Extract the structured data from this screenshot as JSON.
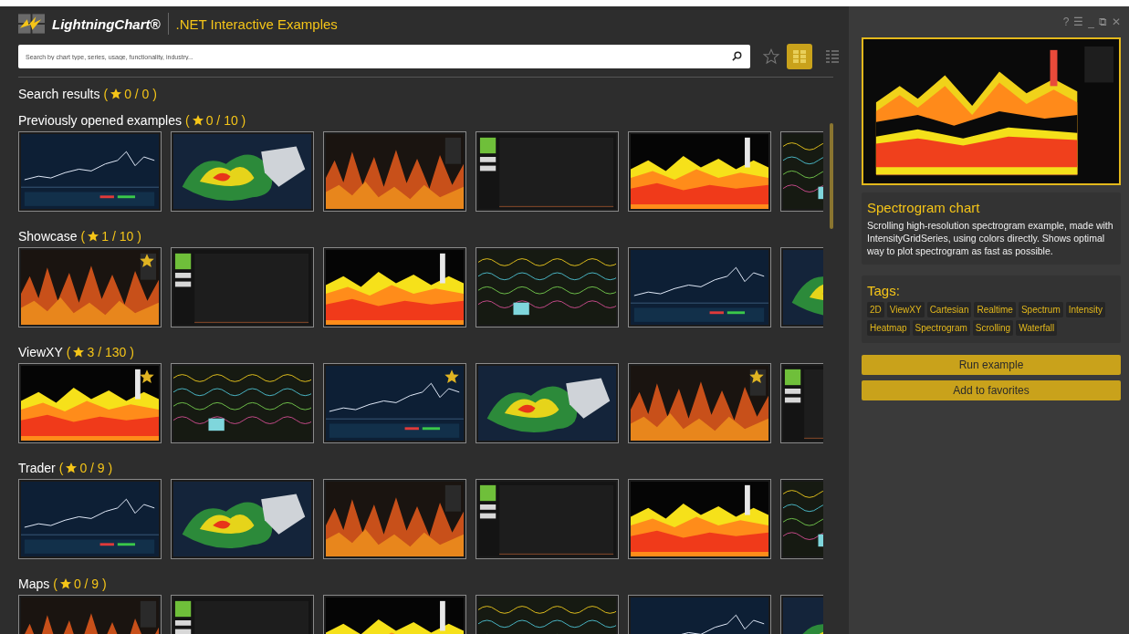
{
  "header": {
    "brand": "LightningChart®",
    "title": ".NET Interactive Examples"
  },
  "search": {
    "placeholder": "Search by chart type, series, usage, functionality, industry..."
  },
  "favorites_filter": {
    "selected": false
  },
  "view_buttons": [
    {
      "kind": "grid",
      "selected": true
    },
    {
      "kind": "list",
      "selected": false
    }
  ],
  "sections": [
    {
      "title": "Search results",
      "badge_open": "(",
      "badge": "0 / 0 )"
    },
    {
      "title": "Previously opened examples",
      "badge_open": "(",
      "badge": "0 / 10 )",
      "thumbnails": [
        {
          "kind": "picture",
          "favorite": false
        },
        {
          "kind": "picture",
          "favorite": false
        },
        {
          "kind": "picture",
          "favorite": false
        },
        {
          "kind": "picture",
          "favorite": false
        },
        {
          "kind": "picture",
          "favorite": false
        },
        {
          "kind": "picture"
        }
      ]
    },
    {
      "title": "Showcase",
      "badge_open": "(",
      "badge": "1 / 10 )",
      "thumbnails": [
        {
          "kind": "picture",
          "favorite": true
        },
        {
          "kind": "picture",
          "favorite": false
        },
        {
          "kind": "picture",
          "favorite": false
        },
        {
          "kind": "picture",
          "favorite": false
        },
        {
          "kind": "picture",
          "favorite": false
        },
        {
          "kind": "picture"
        }
      ]
    },
    {
      "title": "ViewXY",
      "badge_open": "(",
      "badge": "3 / 130 )",
      "thumbnails": [
        {
          "kind": "picture",
          "favorite": true
        },
        {
          "kind": "picture",
          "favorite": false
        },
        {
          "kind": "picture",
          "favorite": true
        },
        {
          "kind": "picture",
          "favorite": false
        },
        {
          "kind": "picture",
          "favorite": true
        },
        {
          "kind": "picture"
        }
      ]
    },
    {
      "title": "Trader",
      "badge_open": "(",
      "badge": "0 / 9 )",
      "thumbnails": [
        {
          "kind": "picture",
          "favorite": false
        },
        {
          "kind": "picture",
          "favorite": false
        },
        {
          "kind": "picture",
          "favorite": false
        },
        {
          "kind": "picture",
          "favorite": false
        },
        {
          "kind": "picture",
          "favorite": false
        },
        {
          "kind": "picture"
        }
      ]
    },
    {
      "title": "Maps",
      "badge_open": "(",
      "badge": "0 / 9 )",
      "thumbnails": [
        {
          "kind": "picture",
          "favorite": false
        },
        {
          "kind": "picture",
          "favorite": false
        },
        {
          "kind": "picture",
          "favorite": false
        },
        {
          "kind": "picture",
          "favorite": false
        },
        {
          "kind": "picture",
          "favorite": false
        },
        {
          "kind": "picture"
        }
      ]
    }
  ],
  "window_controls": [
    "?",
    "☰",
    "_",
    "⧉",
    "✕"
  ],
  "details": {
    "title": "Spectrogram chart",
    "description": "Scrolling high-resolution spectrogram example, made with IntensityGridSeries, using colors directly. Shows optimal way to plot spectrogram as fast as possible.",
    "tags_label": "Tags:",
    "tags": [
      "2D",
      "ViewXY",
      "Cartesian",
      "Realtime",
      "Spectrum",
      "Intensity",
      "Heatmap",
      "Spectrogram",
      "Scrolling",
      "Waterfall"
    ]
  },
  "actions": [
    "Run example",
    "Add to favorites"
  ]
}
